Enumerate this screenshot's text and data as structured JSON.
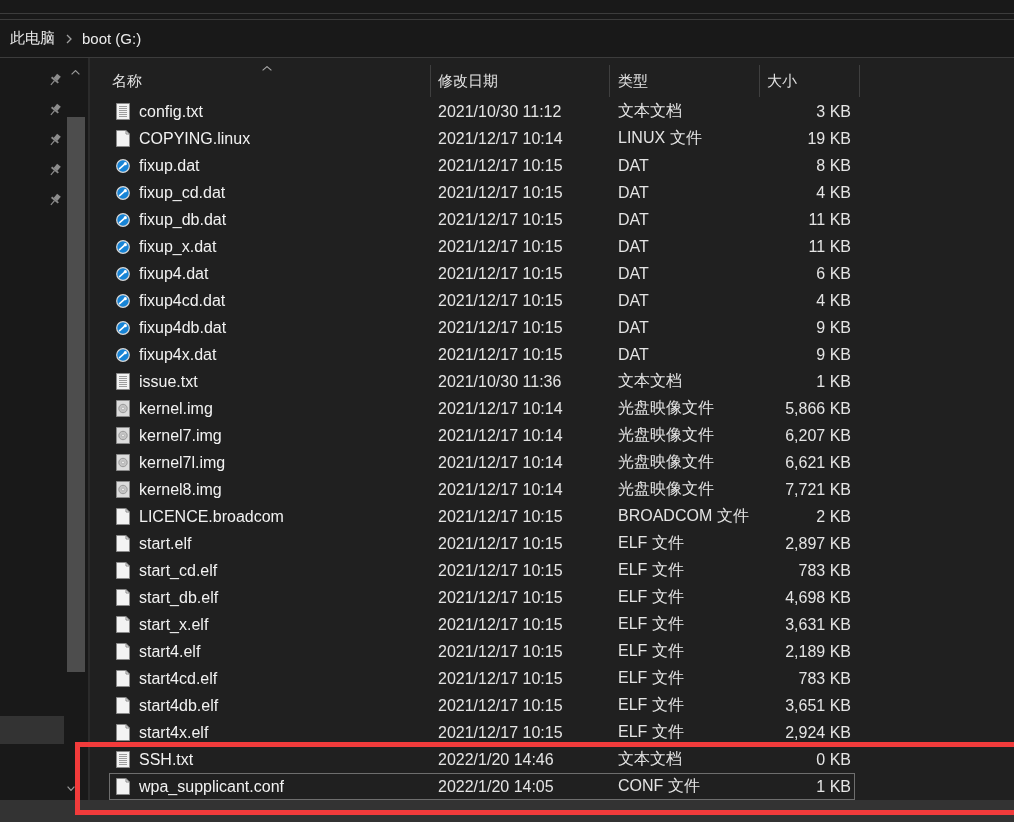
{
  "address_bar": {
    "path": [
      {
        "label": "此电脑"
      },
      {
        "label": "boot (G:)"
      }
    ]
  },
  "navigation_pane": {
    "upper_items": [
      {
        "pinned": true,
        "selected": false
      },
      {
        "pinned": true,
        "selected": false
      },
      {
        "pinned": true,
        "selected": false
      },
      {
        "pinned": true,
        "selected": false
      },
      {
        "pinned": true,
        "selected": false
      }
    ],
    "lower_items": [
      {
        "pinned": false,
        "selected": true
      }
    ]
  },
  "file_list": {
    "columns": [
      {
        "label": "名称",
        "sorted": true
      },
      {
        "label": "修改日期",
        "sorted": false
      },
      {
        "label": "类型",
        "sorted": false
      },
      {
        "label": "大小",
        "sorted": false
      }
    ],
    "rows": [
      {
        "kind": "text",
        "name": "config.txt",
        "modified": "2021/10/30 11:12",
        "type": "文本文档",
        "size": "3 KB",
        "focused": false,
        "highlighted": false
      },
      {
        "kind": "file",
        "name": "COPYING.linux",
        "modified": "2021/12/17 10:14",
        "type": "LINUX 文件",
        "size": "19 KB",
        "focused": false,
        "highlighted": false
      },
      {
        "kind": "dat",
        "name": "fixup.dat",
        "modified": "2021/12/17 10:15",
        "type": "DAT",
        "size": "8 KB",
        "focused": false,
        "highlighted": false
      },
      {
        "kind": "dat",
        "name": "fixup_cd.dat",
        "modified": "2021/12/17 10:15",
        "type": "DAT",
        "size": "4 KB",
        "focused": false,
        "highlighted": false
      },
      {
        "kind": "dat",
        "name": "fixup_db.dat",
        "modified": "2021/12/17 10:15",
        "type": "DAT",
        "size": "11 KB",
        "focused": false,
        "highlighted": false
      },
      {
        "kind": "dat",
        "name": "fixup_x.dat",
        "modified": "2021/12/17 10:15",
        "type": "DAT",
        "size": "11 KB",
        "focused": false,
        "highlighted": false
      },
      {
        "kind": "dat",
        "name": "fixup4.dat",
        "modified": "2021/12/17 10:15",
        "type": "DAT",
        "size": "6 KB",
        "focused": false,
        "highlighted": false
      },
      {
        "kind": "dat",
        "name": "fixup4cd.dat",
        "modified": "2021/12/17 10:15",
        "type": "DAT",
        "size": "4 KB",
        "focused": false,
        "highlighted": false
      },
      {
        "kind": "dat",
        "name": "fixup4db.dat",
        "modified": "2021/12/17 10:15",
        "type": "DAT",
        "size": "9 KB",
        "focused": false,
        "highlighted": false
      },
      {
        "kind": "dat",
        "name": "fixup4x.dat",
        "modified": "2021/12/17 10:15",
        "type": "DAT",
        "size": "9 KB",
        "focused": false,
        "highlighted": false
      },
      {
        "kind": "text",
        "name": "issue.txt",
        "modified": "2021/10/30 11:36",
        "type": "文本文档",
        "size": "1 KB",
        "focused": false,
        "highlighted": false
      },
      {
        "kind": "image",
        "name": "kernel.img",
        "modified": "2021/12/17 10:14",
        "type": "光盘映像文件",
        "size": "5,866 KB",
        "focused": false,
        "highlighted": false
      },
      {
        "kind": "image",
        "name": "kernel7.img",
        "modified": "2021/12/17 10:14",
        "type": "光盘映像文件",
        "size": "6,207 KB",
        "focused": false,
        "highlighted": false
      },
      {
        "kind": "image",
        "name": "kernel7l.img",
        "modified": "2021/12/17 10:14",
        "type": "光盘映像文件",
        "size": "6,621 KB",
        "focused": false,
        "highlighted": false
      },
      {
        "kind": "image",
        "name": "kernel8.img",
        "modified": "2021/12/17 10:14",
        "type": "光盘映像文件",
        "size": "7,721 KB",
        "focused": false,
        "highlighted": false
      },
      {
        "kind": "file",
        "name": "LICENCE.broadcom",
        "modified": "2021/12/17 10:15",
        "type": "BROADCOM 文件",
        "size": "2 KB",
        "focused": false,
        "highlighted": false
      },
      {
        "kind": "file",
        "name": "start.elf",
        "modified": "2021/12/17 10:15",
        "type": "ELF 文件",
        "size": "2,897 KB",
        "focused": false,
        "highlighted": false
      },
      {
        "kind": "file",
        "name": "start_cd.elf",
        "modified": "2021/12/17 10:15",
        "type": "ELF 文件",
        "size": "783 KB",
        "focused": false,
        "highlighted": false
      },
      {
        "kind": "file",
        "name": "start_db.elf",
        "modified": "2021/12/17 10:15",
        "type": "ELF 文件",
        "size": "4,698 KB",
        "focused": false,
        "highlighted": false
      },
      {
        "kind": "file",
        "name": "start_x.elf",
        "modified": "2021/12/17 10:15",
        "type": "ELF 文件",
        "size": "3,631 KB",
        "focused": false,
        "highlighted": false
      },
      {
        "kind": "file",
        "name": "start4.elf",
        "modified": "2021/12/17 10:15",
        "type": "ELF 文件",
        "size": "2,189 KB",
        "focused": false,
        "highlighted": false
      },
      {
        "kind": "file",
        "name": "start4cd.elf",
        "modified": "2021/12/17 10:15",
        "type": "ELF 文件",
        "size": "783 KB",
        "focused": false,
        "highlighted": false
      },
      {
        "kind": "file",
        "name": "start4db.elf",
        "modified": "2021/12/17 10:15",
        "type": "ELF 文件",
        "size": "3,651 KB",
        "focused": false,
        "highlighted": false
      },
      {
        "kind": "file",
        "name": "start4x.elf",
        "modified": "2021/12/17 10:15",
        "type": "ELF 文件",
        "size": "2,924 KB",
        "focused": false,
        "highlighted": false
      },
      {
        "kind": "text",
        "name": "SSH.txt",
        "modified": "2022/1/20 14:46",
        "type": "文本文档",
        "size": "0 KB",
        "focused": false,
        "highlighted": true
      },
      {
        "kind": "file",
        "name": "wpa_supplicant.conf",
        "modified": "2022/1/20 14:05",
        "type": "CONF 文件",
        "size": "1 KB",
        "focused": true,
        "highlighted": true
      }
    ]
  }
}
